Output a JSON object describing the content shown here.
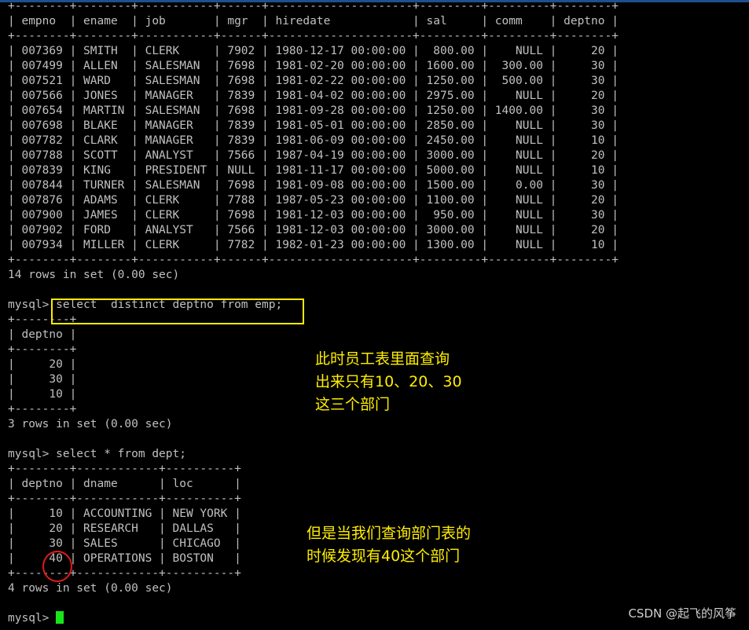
{
  "terminal": {
    "lines": [
      "+--------+--------+-----------+------+---------------------+---------+---------+--------+",
      "| empno  | ename  | job       | mgr  | hiredate            | sal     | comm    | deptno |",
      "+--------+--------+-----------+------+---------------------+---------+---------+--------+",
      "| 007369 | SMITH  | CLERK     | 7902 | 1980-12-17 00:00:00 |  800.00 |    NULL |     20 |",
      "| 007499 | ALLEN  | SALESMAN  | 7698 | 1981-02-20 00:00:00 | 1600.00 |  300.00 |     30 |",
      "| 007521 | WARD   | SALESMAN  | 7698 | 1981-02-22 00:00:00 | 1250.00 |  500.00 |     30 |",
      "| 007566 | JONES  | MANAGER   | 7839 | 1981-04-02 00:00:00 | 2975.00 |    NULL |     20 |",
      "| 007654 | MARTIN | SALESMAN  | 7698 | 1981-09-28 00:00:00 | 1250.00 | 1400.00 |     30 |",
      "| 007698 | BLAKE  | MANAGER   | 7839 | 1981-05-01 00:00:00 | 2850.00 |    NULL |     30 |",
      "| 007782 | CLARK  | MANAGER   | 7839 | 1981-06-09 00:00:00 | 2450.00 |    NULL |     10 |",
      "| 007788 | SCOTT  | ANALYST   | 7566 | 1987-04-19 00:00:00 | 3000.00 |    NULL |     20 |",
      "| 007839 | KING   | PRESIDENT | NULL | 1981-11-17 00:00:00 | 5000.00 |    NULL |     10 |",
      "| 007844 | TURNER | SALESMAN  | 7698 | 1981-09-08 00:00:00 | 1500.00 |    0.00 |     30 |",
      "| 007876 | ADAMS  | CLERK     | 7788 | 1987-05-23 00:00:00 | 1100.00 |    NULL |     20 |",
      "| 007900 | JAMES  | CLERK     | 7698 | 1981-12-03 00:00:00 |  950.00 |    NULL |     30 |",
      "| 007902 | FORD   | ANALYST   | 7566 | 1981-12-03 00:00:00 | 3000.00 |    NULL |     20 |",
      "| 007934 | MILLER | CLERK     | 7782 | 1982-01-23 00:00:00 | 1300.00 |    NULL |     10 |",
      "+--------+--------+-----------+------+---------------------+---------+---------+--------+",
      "14 rows in set (0.00 sec)",
      "",
      "mysql> select  distinct deptno from emp;",
      "+--------+",
      "| deptno |",
      "+--------+",
      "|     20 |",
      "|     30 |",
      "|     10 |",
      "+--------+",
      "3 rows in set (0.00 sec)",
      "",
      "mysql> select * from dept;",
      "+--------+------------+----------+",
      "| deptno | dname      | loc      |",
      "+--------+------------+----------+",
      "|     10 | ACCOUNTING | NEW YORK |",
      "|     20 | RESEARCH   | DALLAS   |",
      "|     30 | SALES      | CHICAGO  |",
      "|     40 | OPERATIONS | BOSTON   |",
      "+--------+------------+----------+",
      "4 rows in set (0.00 sec)",
      "",
      "mysql> "
    ]
  },
  "annotations": {
    "note1": "此时员工表里面查询\n出来只有10、20、30\n这三个部门",
    "note2": "但是当我们查询部门表的\n时候发现有40这个部门"
  },
  "watermark": "CSDN @起飞的风筝",
  "colors": {
    "terminal_bg": "#000000",
    "terminal_text": "#c0c0c0",
    "highlight_box": "#ffea00",
    "circle": "#e11b1b",
    "note_text": "#ffee00",
    "cursor": "#19e619"
  }
}
